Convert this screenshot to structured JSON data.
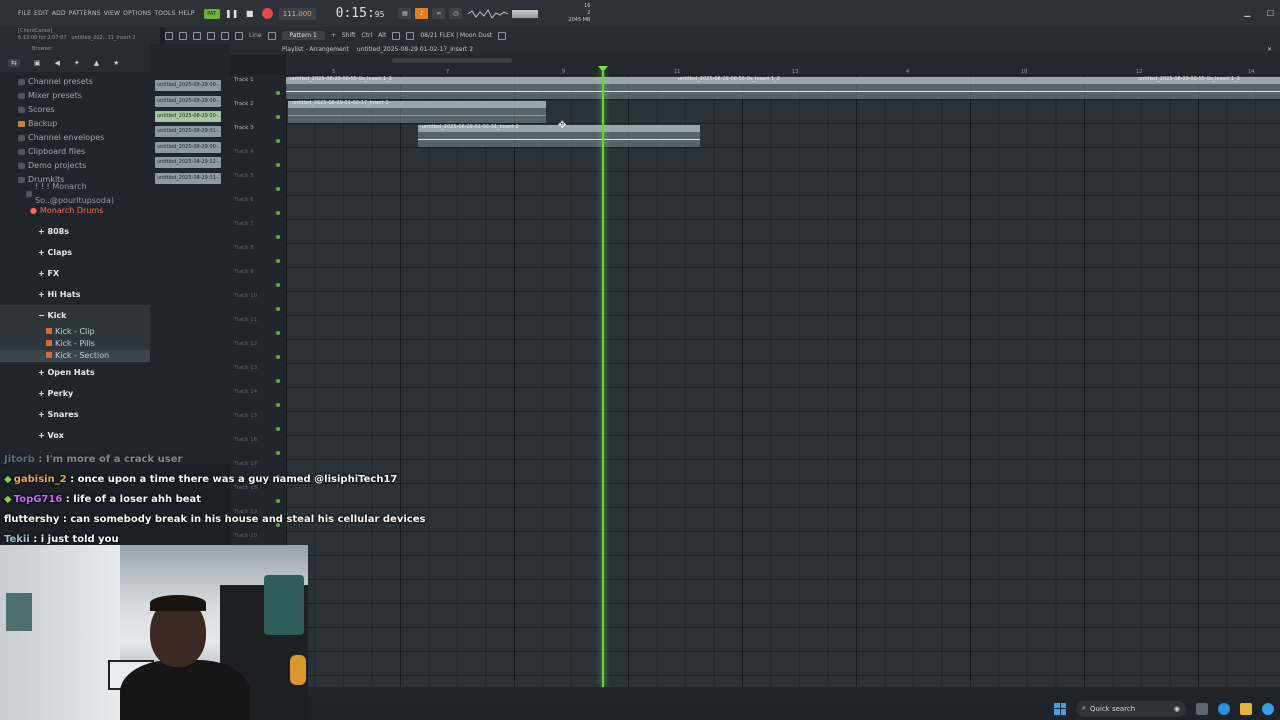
{
  "menu": [
    "FILE",
    "EDIT",
    "ADD",
    "PATTERNS",
    "VIEW",
    "OPTIONS",
    "TOOLS",
    "HELP"
  ],
  "transport": {
    "pattern_toggle": "PAT",
    "bpm": "111.000",
    "time_main": "0:15:",
    "time_sub": "95",
    "cpu_line1": "16",
    "cpu_line2": "2",
    "mem": "2045 MB"
  },
  "hint": {
    "line1": "[ChordCarlos]",
    "line2": "6:13:06 for 2:07:07",
    "line3": "untitled_202...31_Insert 2"
  },
  "toolbar2": {
    "line_mode": "Line",
    "pattern": "Pattern 1",
    "shift": "Shift",
    "ctrl": "Ctrl",
    "alt": "Alt",
    "news": "08/21 FLEX | Moon Dust"
  },
  "browser": {
    "label": "Browser",
    "items": [
      {
        "label": "Channel presets"
      },
      {
        "label": "Mixer presets"
      },
      {
        "label": "Scores"
      },
      {
        "label": "Backup"
      },
      {
        "label": "Channel envelopes"
      },
      {
        "label": "Clipboard files"
      },
      {
        "label": "Demo projects"
      },
      {
        "label": "Drumkits"
      }
    ],
    "pack": "! ! ! Monarch So..@pouritupsoda)",
    "selected": "Monarch Drums",
    "drum_folders": [
      "808s",
      "Claps",
      "FX",
      "Hi Hats",
      "Kick"
    ],
    "kick_items": [
      "Kick - Clip",
      "Kick - Pills",
      "Kick - Section"
    ],
    "drum_folders_2": [
      "Open Hats",
      "Perky",
      "Snares",
      "Vox"
    ]
  },
  "channels": [
    "untitled_2025-08-29 00-...",
    "untitled_2025-08-29 00-...",
    "untitled_2025-08-29 00-...",
    "untitled_2025-08-29 01-...",
    "untitled_2025-08-29 00-...",
    "untitled_2025-08-29 02-...",
    "untitled_2025-08-29 01-..."
  ],
  "playlist": {
    "title": "Playlist - Arrangement",
    "project": "untitled_2025-08-29 01-02-17_Insert 2",
    "ticks": [
      "5",
      "7",
      "9",
      "11",
      "13",
      "3",
      "4",
      "10",
      "12",
      "14"
    ],
    "tracks": [
      "Track 1",
      "Track 2",
      "Track 3",
      "Track 4",
      "Track 5",
      "Track 6",
      "Track 7",
      "Track 8",
      "Track 9",
      "Track 10",
      "Track 11",
      "Track 12",
      "Track 13",
      "Track 14",
      "Track 15",
      "Track 16",
      "Track 17",
      "Track 18",
      "Track 19",
      "Track 20"
    ],
    "clips": [
      {
        "name": "untitled_2025-08-29 00-55-0s_Insert 1_2"
      },
      {
        "name": "untitled_2025-08-29 00-55-0s_Insert 1_2"
      },
      {
        "name": "untitled_2025-08-29 00-55-0s_Insert 1_2"
      },
      {
        "name": "untitled_2025-08-29 01-02-17_Insert 2"
      },
      {
        "name": "untitled_2025-08-29 01-03-31_Insert 2"
      }
    ]
  },
  "chat": [
    {
      "user": "Jitorb",
      "msg": " : I'm more of a crack user"
    },
    {
      "user": "gabisin_2",
      "msg": " : once upon a time there was a guy named @lisiphiTech17"
    },
    {
      "user": "TopG716",
      "msg": " : life of a loser ahh beat"
    },
    {
      "user": "fluttershy",
      "msg": " : can somebody break in his house and steal his cellular devices"
    },
    {
      "user": "Tekii",
      "msg": " : i just told you"
    }
  ],
  "taskbar": {
    "search": "Quick search"
  }
}
